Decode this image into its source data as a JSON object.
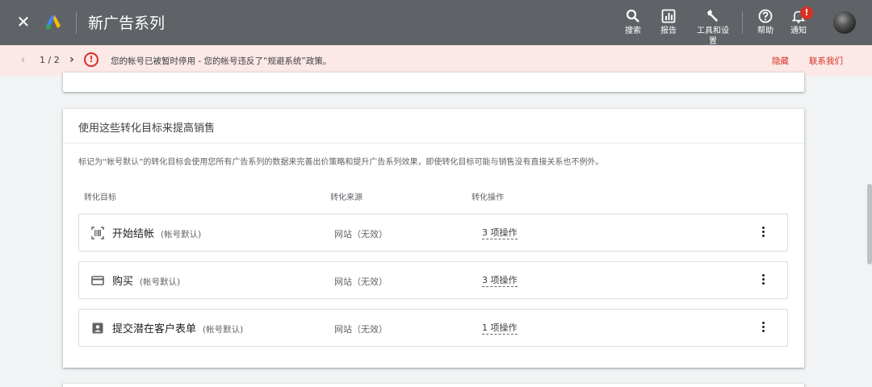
{
  "header": {
    "title": "新广告系列",
    "tools": [
      {
        "icon": "search-icon",
        "label": "搜索"
      },
      {
        "icon": "report-icon",
        "label": "报告"
      },
      {
        "icon": "wrench-icon",
        "label": "工具和设置"
      },
      {
        "icon": "help-icon",
        "label": "帮助"
      },
      {
        "icon": "bell-icon",
        "label": "通知"
      }
    ],
    "notification_badge": "!"
  },
  "alert": {
    "page": "1 / 2",
    "message": "您的帐号已被暂时停用 - 您的帐号违反了“规避系统”政策。",
    "hide_label": "隐藏",
    "contact_label": "联系我们"
  },
  "card": {
    "title": "使用这些转化目标来提高销售",
    "description": "标记为“帐号默认”的转化目标会使用您所有广告系列的数据来完善出价策略和提升广告系列效果，即使转化目标可能与销售没有直接关系也不例外。",
    "columns": [
      "转化目标",
      "转化来源",
      "转化操作"
    ],
    "rows": [
      {
        "icon": "barcode-scan-icon",
        "name": "开始结帐",
        "default_label": "(帐号默认)",
        "source": "网站（无效）",
        "actions": "3 项操作"
      },
      {
        "icon": "credit-card-icon",
        "name": "购买",
        "default_label": "(帐号默认)",
        "source": "网站（无效）",
        "actions": "3 项操作"
      },
      {
        "icon": "contact-form-icon",
        "name": "提交潜在客户表单",
        "default_label": "(帐号默认)",
        "source": "网站（无效）",
        "actions": "1 项操作"
      }
    ]
  },
  "colors": {
    "topbar": "#5f6368",
    "alert_bg": "#fce8e6",
    "alert_accent": "#d93025"
  }
}
